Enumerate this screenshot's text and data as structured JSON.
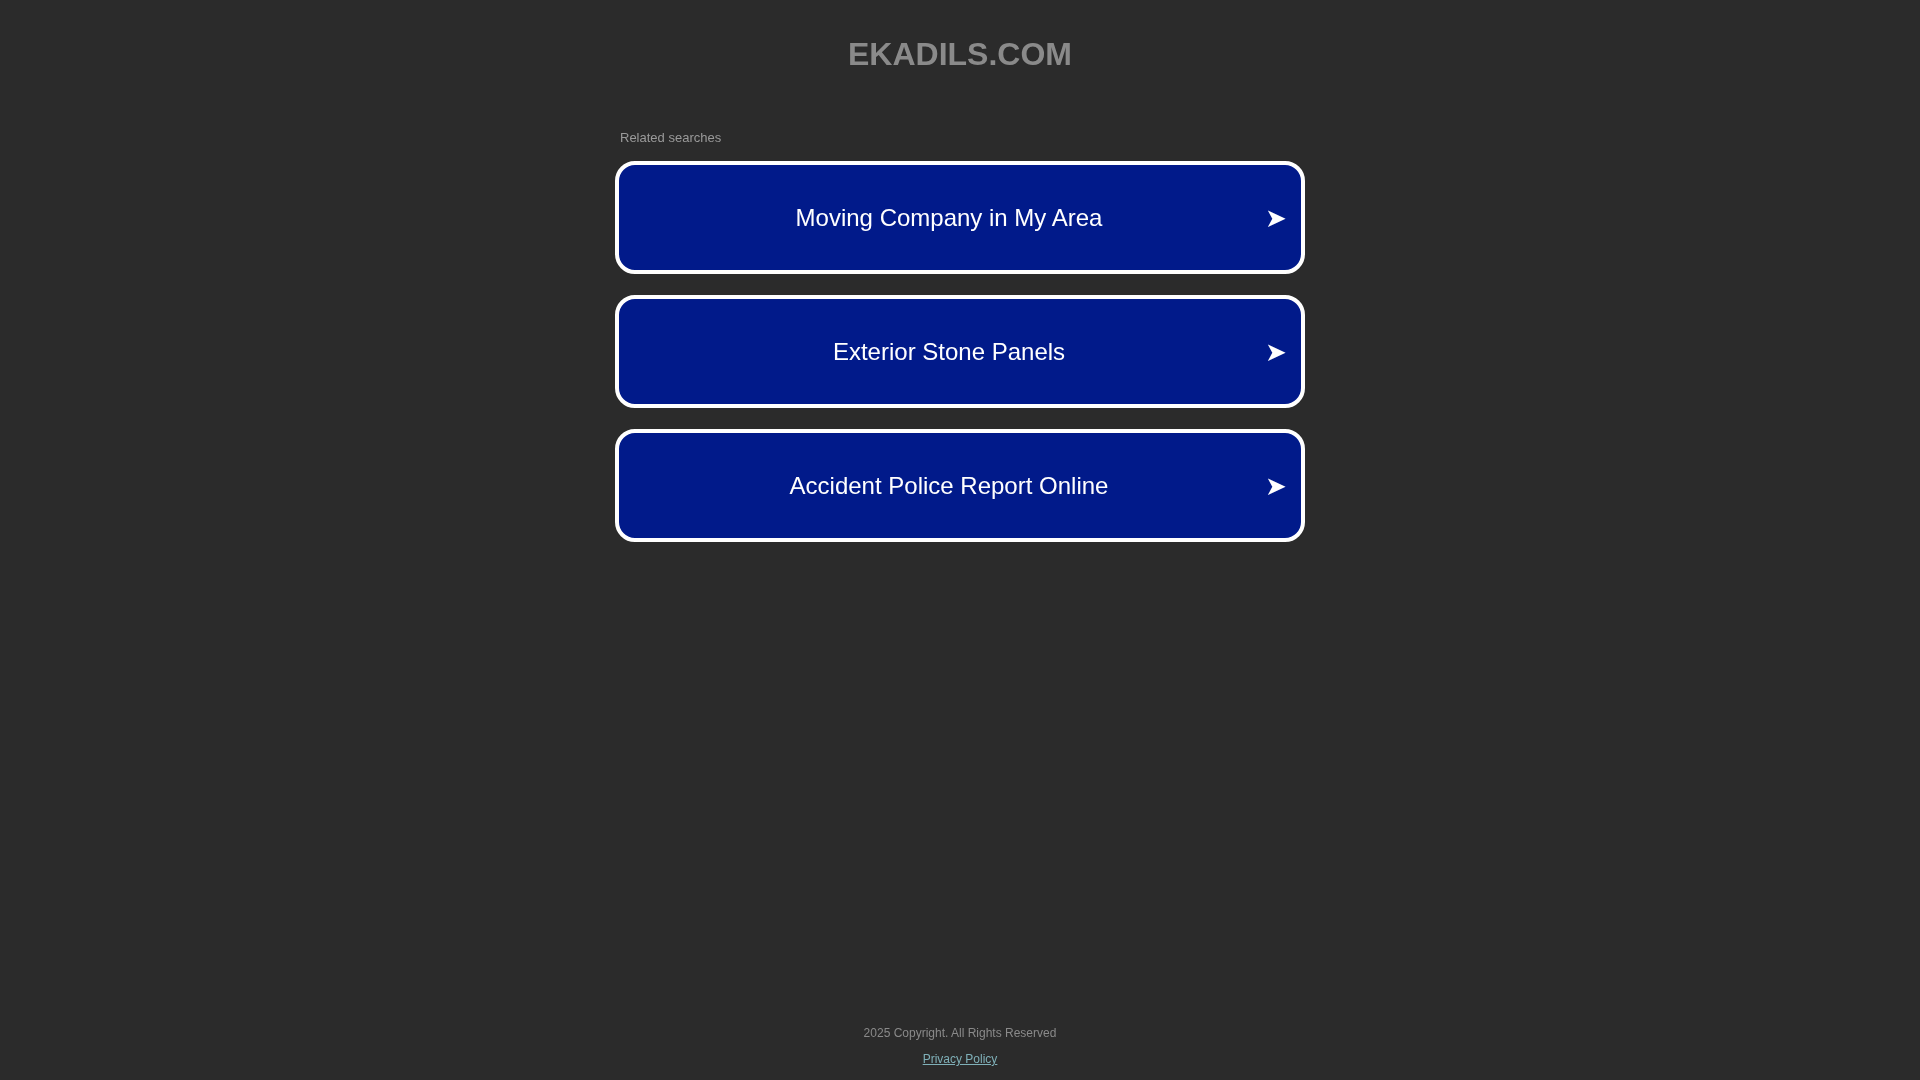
{
  "site_title": "EKADILS.COM",
  "related_heading": "Related searches",
  "links": [
    {
      "label": "Moving Company in My Area",
      "arrow": "➤"
    },
    {
      "label": "Exterior Stone Panels",
      "arrow": "➤"
    },
    {
      "label": "Accident Police Report Online",
      "arrow": "➤"
    }
  ],
  "footer": {
    "copyright": "2025 Copyright. All Rights Reserved",
    "privacy_link": "Privacy Policy"
  }
}
